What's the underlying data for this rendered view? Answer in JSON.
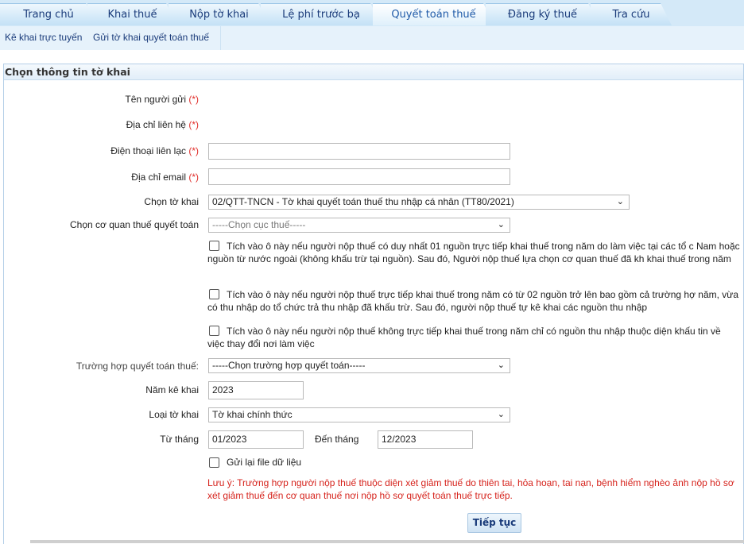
{
  "tabs": [
    "Trang chủ",
    "Khai thuế",
    "Nộp tờ khai",
    "Lệ phí trước bạ",
    "Quyết toán thuế",
    "Đăng ký thuế",
    "Tra cứu"
  ],
  "subnav": {
    "item1": "Kê khai trực tuyến",
    "item2": "Gửi tờ khai quyết toán thuế"
  },
  "panel_title": "Chọn thông tin tờ khai",
  "form": {
    "sender_name_label": "Tên người gửi ",
    "address_label": "Địa chỉ liên hệ ",
    "phone_label": "Điện thoại liên lạc ",
    "email_label": "Địa chỉ email ",
    "required_mark": "(*)",
    "form_select_label": "Chọn tờ khai",
    "form_select_value": "02/QTT-TNCN - Tờ khai quyết toán thuế thu nhập cá nhân (TT80/2021)",
    "agency_label": "Chọn cơ quan thuế quyết toán",
    "agency_value": "-----Chọn cục thuế-----",
    "checkbox1_text": "Tích vào ô này nếu người nộp thuế có duy nhất 01 nguồn trực tiếp khai thuế trong năm do làm việc tại các tổ c Nam hoặc nguồn từ nước ngoài (không khấu trừ tại nguồn). Sau đó, Người nộp thuế lựa chọn cơ quan thuế đã kh khai thuế trong năm",
    "checkbox2_text": "Tích vào ô này nếu người nộp thuế trực tiếp khai thuế trong năm có từ 02 nguồn trở lên bao gồm cả trường hợ năm, vừa có thu nhập do tổ chức trả thu nhập đã khấu trừ. Sau đó, người nộp thuế tự kê khai các nguồn thu nhập",
    "checkbox3_text": "Tích vào ô này nếu người nộp thuế không trực tiếp khai thuế trong năm chỉ có nguồn thu nhập thuộc diện khấu tin về việc thay đổi nơi làm việc",
    "case_label": "Trường hợp quyết toán thuế:",
    "case_value": "-----Chọn trường hợp quyết toán-----",
    "year_label": "Năm kê khai",
    "year_value": "2023",
    "type_label": "Loại tờ khai",
    "type_value": "Tờ khai chính thức",
    "from_label": "Từ tháng",
    "from_value": "01/2023",
    "to_label": "Đến tháng",
    "to_value": "12/2023",
    "resend_label": "Gửi lại file dữ liệu",
    "note": "Lưu ý: Trường hợp người nộp thuế thuộc diện xét giảm thuế do thiên tai, hỏa hoạn, tai nạn, bệnh hiểm nghèo ảnh nộp hồ sơ xét giảm thuế đến cơ quan thuế nơi nộp hồ sơ quyết toán thuế trực tiếp.",
    "continue_button": "Tiếp tục"
  },
  "colors": {
    "tab_text": "#1a3b7a",
    "active_tab_text": "#1f5aa8",
    "required": "#e0302c",
    "note": "#d6231c"
  },
  "icons": [
    "chevron-down-icon",
    "checkbox-icon"
  ]
}
